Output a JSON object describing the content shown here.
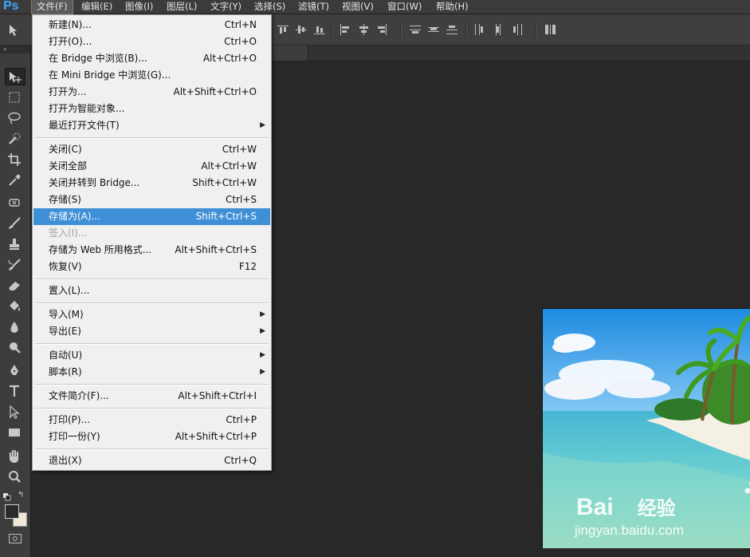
{
  "app": {
    "logo": "Ps"
  },
  "menubar": {
    "items": [
      {
        "label": "文件(F)",
        "active": true
      },
      {
        "label": "编辑(E)"
      },
      {
        "label": "图像(I)"
      },
      {
        "label": "图层(L)"
      },
      {
        "label": "文字(Y)"
      },
      {
        "label": "选择(S)"
      },
      {
        "label": "滤镜(T)"
      },
      {
        "label": "视图(V)"
      },
      {
        "label": "窗口(W)"
      },
      {
        "label": "帮助(H)"
      }
    ]
  },
  "file_menu": {
    "items": [
      {
        "label": "新建(N)...",
        "shortcut": "Ctrl+N"
      },
      {
        "label": "打开(O)...",
        "shortcut": "Ctrl+O"
      },
      {
        "label": "在 Bridge 中浏览(B)...",
        "shortcut": "Alt+Ctrl+O"
      },
      {
        "label": "在 Mini Bridge 中浏览(G)...",
        "shortcut": ""
      },
      {
        "label": "打开为...",
        "shortcut": "Alt+Shift+Ctrl+O"
      },
      {
        "label": "打开为智能对象...",
        "shortcut": ""
      },
      {
        "label": "最近打开文件(T)",
        "shortcut": "",
        "submenu": true
      },
      {
        "label": "关闭(C)",
        "shortcut": "Ctrl+W"
      },
      {
        "label": "关闭全部",
        "shortcut": "Alt+Ctrl+W"
      },
      {
        "label": "关闭并转到 Bridge...",
        "shortcut": "Shift+Ctrl+W"
      },
      {
        "label": "存储(S)",
        "shortcut": "Ctrl+S"
      },
      {
        "label": "存储为(A)...",
        "shortcut": "Shift+Ctrl+S",
        "highlighted": true
      },
      {
        "label": "签入(I)...",
        "shortcut": "",
        "disabled": true
      },
      {
        "label": "存储为 Web 所用格式...",
        "shortcut": "Alt+Shift+Ctrl+S"
      },
      {
        "label": "恢复(V)",
        "shortcut": "F12"
      },
      {
        "label": "置入(L)...",
        "shortcut": ""
      },
      {
        "label": "导入(M)",
        "shortcut": "",
        "submenu": true
      },
      {
        "label": "导出(E)",
        "shortcut": "",
        "submenu": true
      },
      {
        "label": "自动(U)",
        "shortcut": "",
        "submenu": true
      },
      {
        "label": "脚本(R)",
        "shortcut": "",
        "submenu": true
      },
      {
        "label": "文件简介(F)...",
        "shortcut": "Alt+Shift+Ctrl+I"
      },
      {
        "label": "打印(P)...",
        "shortcut": "Ctrl+P"
      },
      {
        "label": "打印一份(Y)",
        "shortcut": "Alt+Shift+Ctrl+P"
      },
      {
        "label": "退出(X)",
        "shortcut": "Ctrl+Q"
      }
    ]
  },
  "submenu_arrow": "▶",
  "toolbar": {
    "tools": [
      "move-tool-icon",
      "marquee-tool-icon",
      "lasso-tool-icon",
      "quick-selection-tool-icon",
      "crop-tool-icon",
      "eyedropper-tool-icon",
      "healing-brush-tool-icon",
      "brush-tool-icon",
      "clone-stamp-tool-icon",
      "history-brush-tool-icon",
      "eraser-tool-icon",
      "paint-bucket-tool-icon",
      "blur-tool-icon",
      "dodge-tool-icon",
      "pen-tool-icon",
      "type-tool-icon",
      "path-selection-tool-icon",
      "rectangle-tool-icon",
      "hand-tool-icon",
      "zoom-tool-icon"
    ]
  },
  "colors": {
    "highlight": "#3f8fd7",
    "foreground_swatch": "#2b2b2b",
    "background_swatch": "#f0e7d4"
  },
  "watermark": {
    "brand": "Bai",
    "brand_suffix": "经验",
    "url": "jingyan.baidu.com"
  }
}
